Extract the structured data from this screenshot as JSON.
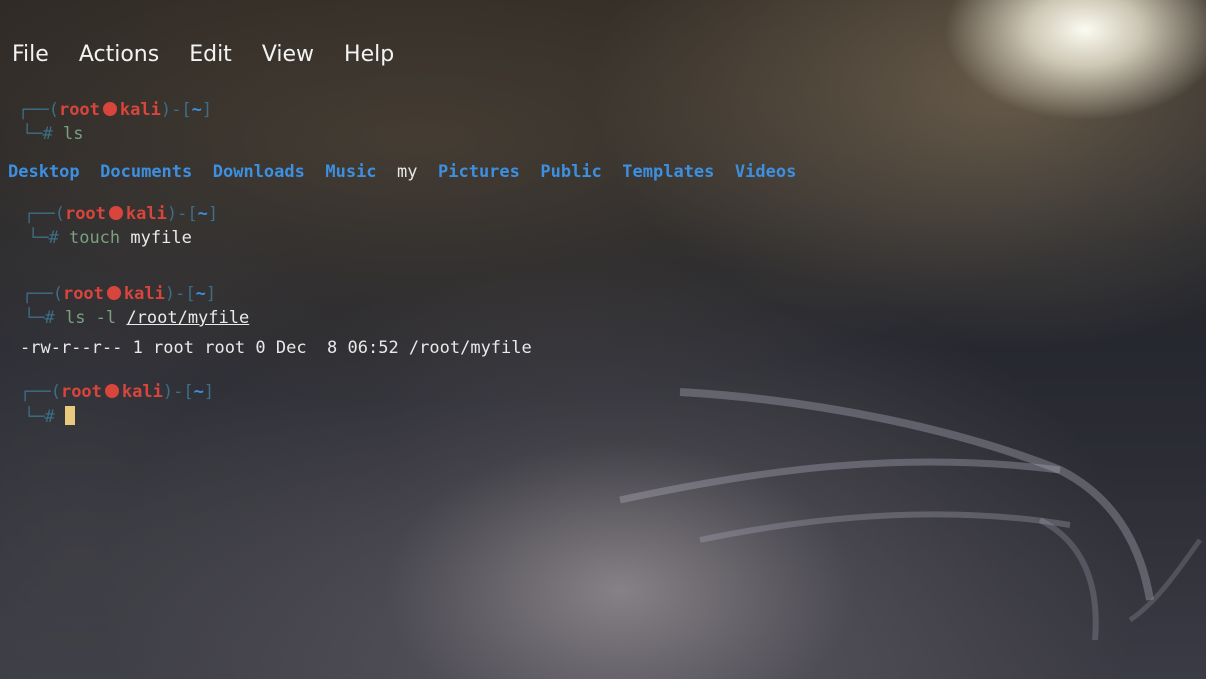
{
  "menu": [
    "File",
    "Actions",
    "Edit",
    "View",
    "Help"
  ],
  "prompt": {
    "open": "┌──(",
    "user": "root",
    "host": "kali",
    "close": ")-[",
    "dir": "~",
    "end": "]",
    "hash": "└─#"
  },
  "commands": {
    "c1": "ls",
    "c2_a": "touch",
    "c2_b": "myfile",
    "c3_a": "ls -l",
    "c3_b": "/root/myfile"
  },
  "ls_output": [
    "Desktop",
    "Documents",
    "Downloads",
    "Music",
    "my",
    "Pictures",
    "Public",
    "Templates",
    "Videos"
  ],
  "ls_l_output": "-rw-r--r-- 1 root root 0 Dec  8 06:52 /root/myfile",
  "colors": {
    "prompt_frame": "#3d6e86",
    "user_host": "#d8453d",
    "directory": "#3d8fe0",
    "cursor": "#e9c97d"
  }
}
